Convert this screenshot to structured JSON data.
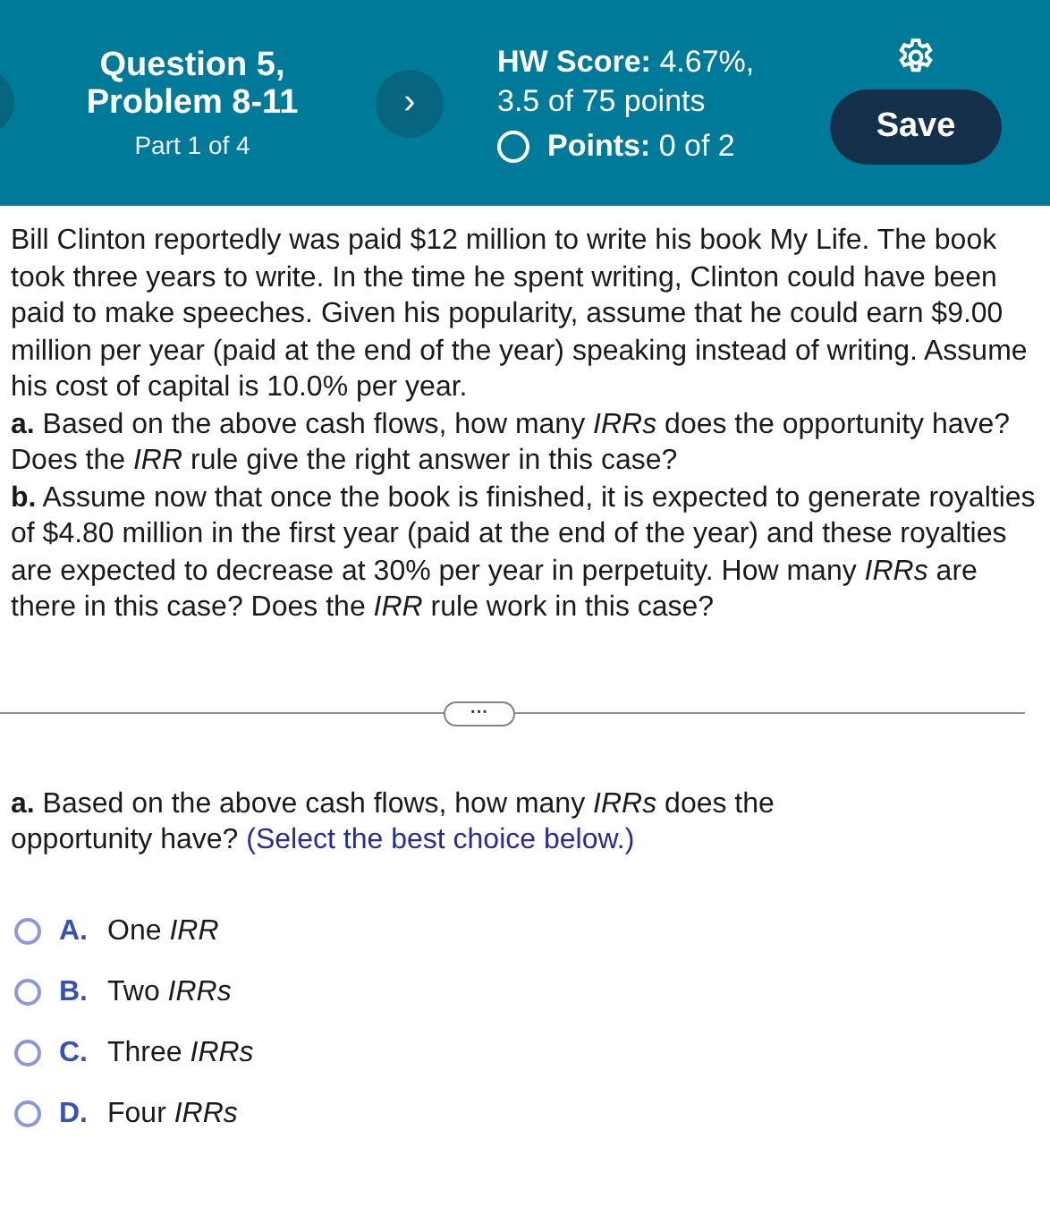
{
  "header": {
    "title": "Question 5, Problem 8-11",
    "part": "Part 1 of 4",
    "next_button": "›",
    "hw_score": "**HW Score:** 4.67%, 3.5 of 75 points",
    "points": "**Points:** 0 of 2",
    "save_button": "Save"
  },
  "problem": [
    "Bill Clinton reportedly was paid $12 million to write his book My Life. The book took three years to write. In the time he spent writing, Clinton could have been paid to make speeches. Given his popularity, assume that he could earn $9.00 million per year (paid at the end of the year) speaking instead of writing. Assume his cost of capital is 10.0% per year.",
    "**a.** Based on the above cash flows, how many *IRRs* does the opportunity have? Does the *IRR* rule give the right answer in this case?",
    "**b.** Assume now that once the book is finished, it is expected to generate royalties of $4.80 million in the first year (paid at the end of the year) and these royalties are expected to decrease at 30% per year in perpetuity. How many *IRRs* are there in this case? Does the *IRR* rule work in this case?"
  ],
  "expand_button": "···",
  "question": {
    "prompt": "**a.** Based on the above cash flows, how many *IRRs* does the opportunity have?",
    "hint": "(Select the best choice below.)"
  },
  "choices": [
    {
      "letter": "A.",
      "text": "One *IRR*",
      "selected": false
    },
    {
      "letter": "B.",
      "text": "Two *IRRs*",
      "selected": false
    },
    {
      "letter": "C.",
      "text": "Three *IRRs*",
      "selected": false
    },
    {
      "letter": "D.",
      "text": "Four *IRRs*",
      "selected": false
    }
  ]
}
